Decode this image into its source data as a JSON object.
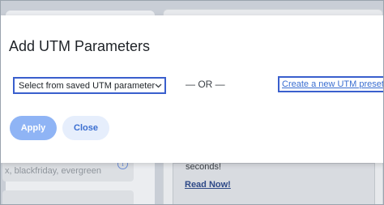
{
  "background": {
    "tags_placeholder": "x, blackfriday, evergreen",
    "info_icon": "i",
    "preview_text": "seconds!",
    "read_now_link": "Read Now!"
  },
  "modal": {
    "title": "Add UTM Parameters",
    "select": {
      "selected_value": "Select from saved UTM parameter"
    },
    "or_divider": "— OR —",
    "create_link": "Create a new UTM preset",
    "apply_button": "Apply",
    "close_button": "Close"
  },
  "colors": {
    "focus_outline": "#3a5fcd",
    "link": "#3a6ed1",
    "apply_bg": "#8fb4f5",
    "close_bg": "#e6eefc"
  },
  "icons": {
    "select_chevron": "chevron-down-icon",
    "info": "info-icon"
  }
}
